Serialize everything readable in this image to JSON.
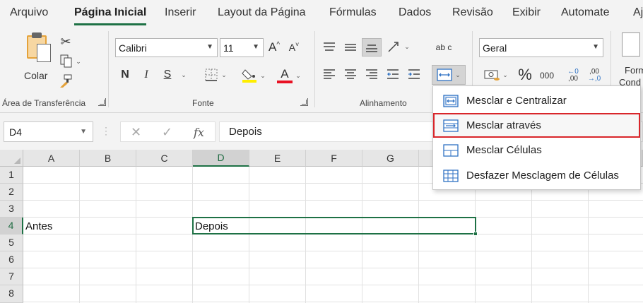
{
  "menu": {
    "tabs": [
      "Arquivo",
      "Página Inicial",
      "Inserir",
      "Layout da Página",
      "Fórmulas",
      "Dados",
      "Revisão",
      "Exibir",
      "Automate",
      "Aj"
    ],
    "active": "Página Inicial"
  },
  "ribbon": {
    "clipboard": {
      "paste_label": "Colar",
      "group_label": "Área de Transferência"
    },
    "font": {
      "font_name": "Calibri",
      "font_size": "11",
      "bold": "N",
      "italic": "I",
      "underline": "S",
      "font_color_glyph": "A",
      "group_label": "Fonte"
    },
    "alignment": {
      "wrap_glyph": "ab c",
      "group_label": "Alinhamento"
    },
    "number": {
      "format": "Geral",
      "percent": "%",
      "thousands": "000",
      "inc_decimal": ",00",
      "dec_decimal": ",00",
      "inc_decimal_small": "←0",
      "dec_decimal_small": "→,0"
    },
    "styles": {
      "label_top": "Form",
      "label_bottom": "Cond"
    }
  },
  "formula_bar": {
    "name_box": "D4",
    "cancel": "✕",
    "enter": "✓",
    "fx": "fx",
    "content": "Depois"
  },
  "grid": {
    "columns": [
      "A",
      "B",
      "C",
      "D",
      "E",
      "F",
      "G"
    ],
    "rows": [
      "1",
      "2",
      "3",
      "4",
      "5",
      "6",
      "7",
      "8"
    ],
    "selected_column": "D",
    "selected_row": "4",
    "cells": {
      "A4": "Antes",
      "D4": "Depois"
    }
  },
  "merge_menu": {
    "items": [
      {
        "label": "Mesclar e Centralizar",
        "icon": "merge-center-icon"
      },
      {
        "label": "Mesclar através",
        "icon": "merge-across-icon"
      },
      {
        "label": "Mesclar Células",
        "icon": "merge-cells-icon"
      },
      {
        "label": "Desfazer Mesclagem de Células",
        "icon": "unmerge-cells-icon"
      }
    ],
    "highlighted_index": 1
  },
  "colors": {
    "accent": "#1e7145",
    "highlight_border": "#d9262b",
    "fill_yellow": "#ffee00",
    "font_red": "#e81123",
    "merge_icon_blue": "#2f72c4"
  }
}
